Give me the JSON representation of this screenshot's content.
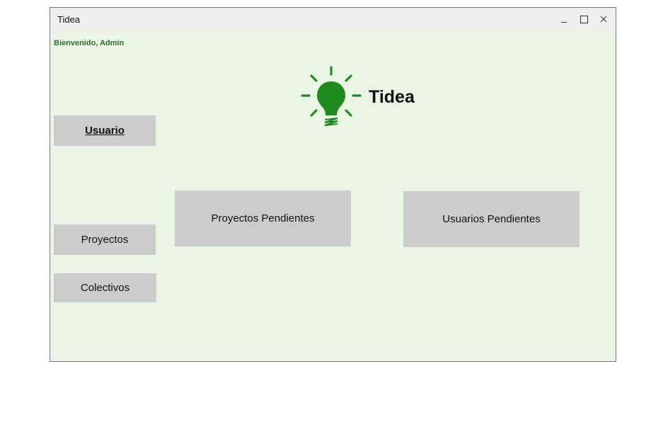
{
  "window": {
    "title": "Tidea",
    "controls": {
      "minimize_icon": "minimize-icon",
      "maximize_icon": "maximize-icon",
      "close_icon": "close-icon"
    }
  },
  "header": {
    "welcome_text": "Bienvenido, Admin",
    "logo_text": "Tidea",
    "logo_icon": "lightbulb-icon"
  },
  "sidebar": {
    "usuario_label": "Usuario",
    "proyectos_label": "Proyectos",
    "colectivos_label": "Colectivos"
  },
  "main": {
    "proyectos_pendientes_label": "Proyectos Pendientes",
    "usuarios_pendientes_label": "Usuarios Pendientes"
  },
  "colors": {
    "background": "#eaf5e6",
    "titlebar": "#efefef",
    "button": "#cccccc",
    "brand_green": "#1f8a1f",
    "welcome_green": "#2f6e2b"
  }
}
